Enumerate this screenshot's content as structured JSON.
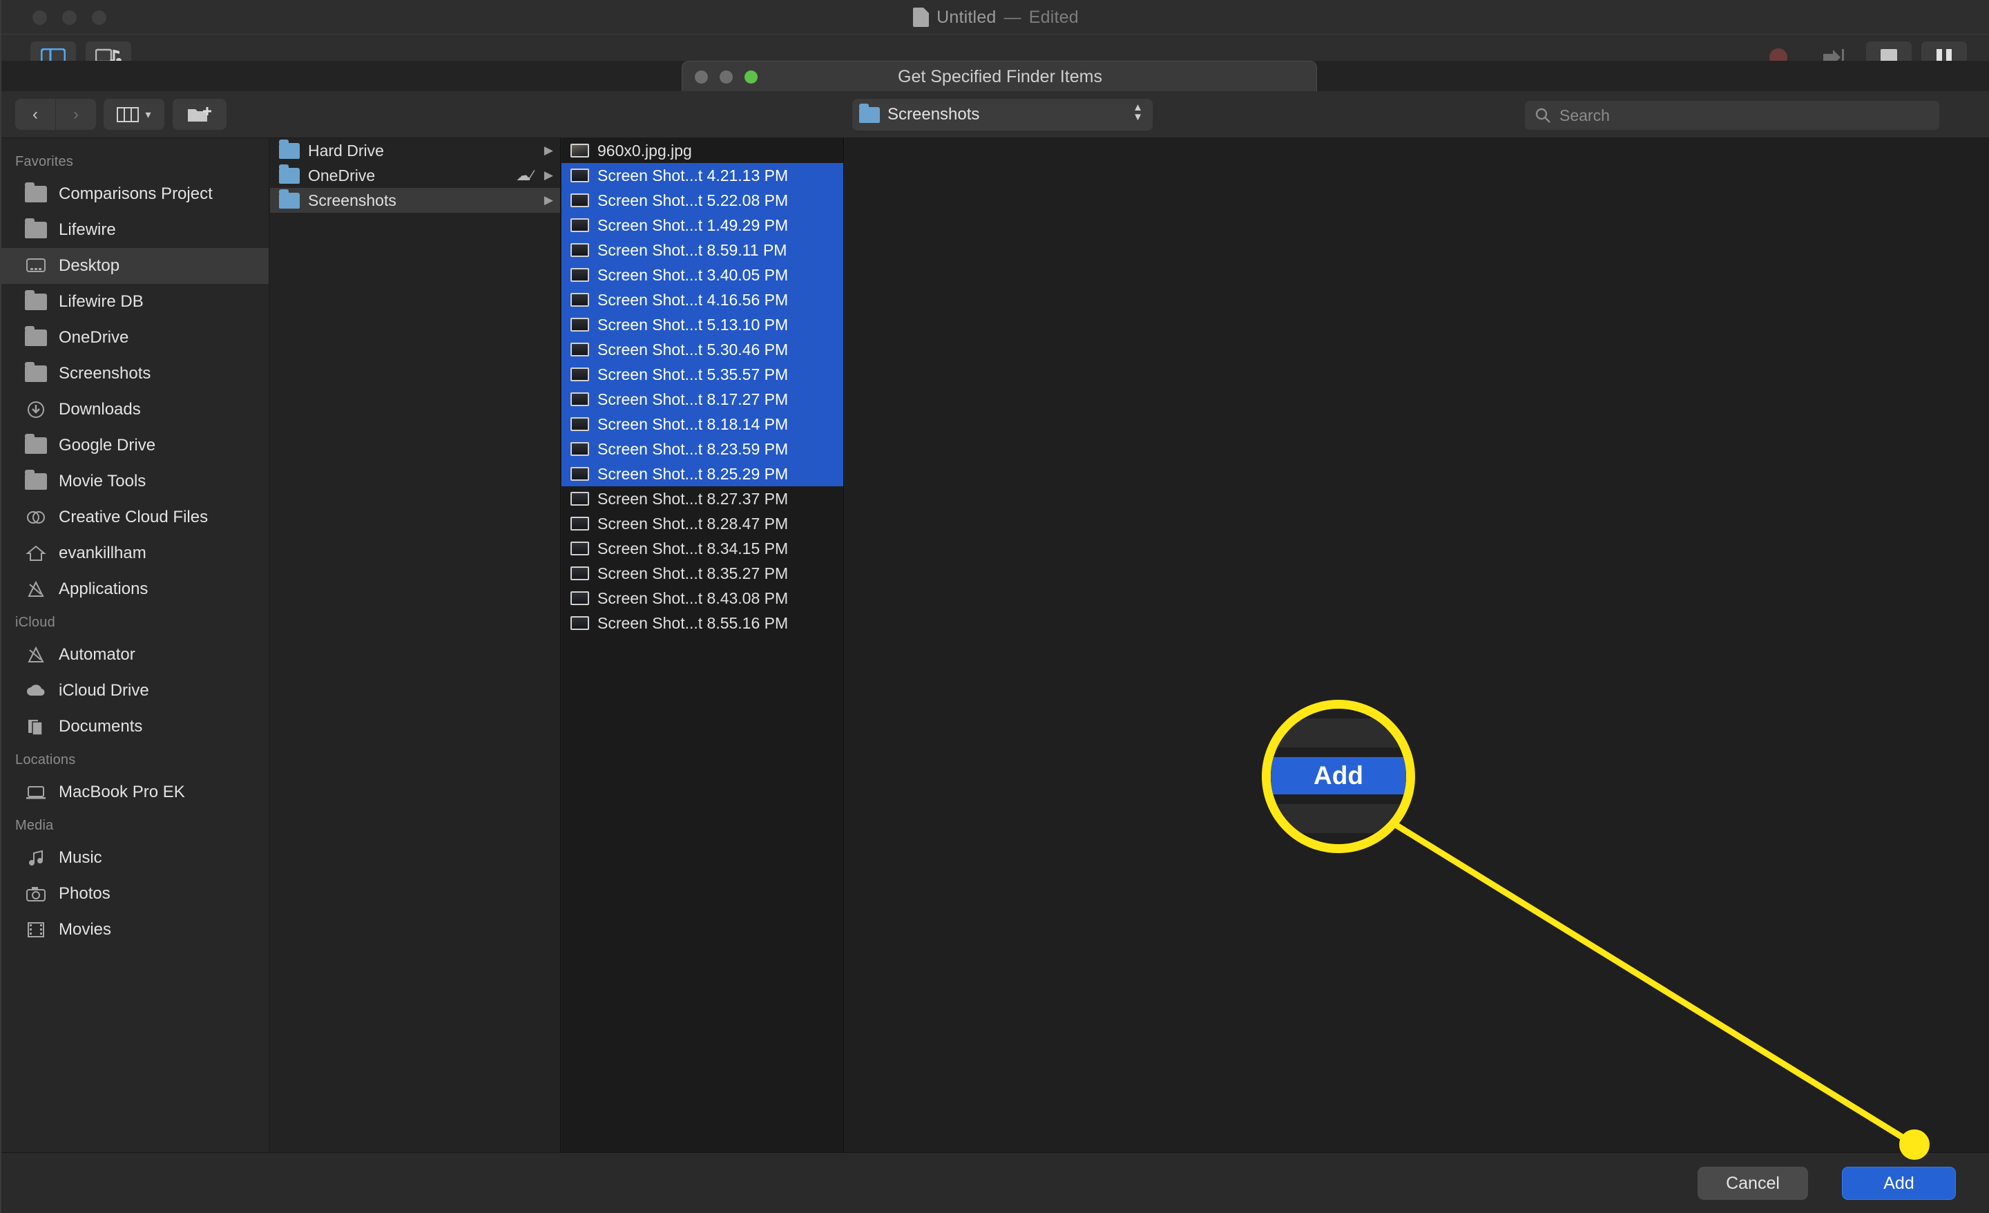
{
  "app": {
    "title": "Untitled",
    "title_separator": "—",
    "title_state": "Edited",
    "toolbar_left": [
      {
        "label": "Library",
        "icon": "library-panel-icon",
        "active": true
      },
      {
        "label": "Media",
        "icon": "media-icon",
        "active": false
      }
    ],
    "toolbar_right": [
      {
        "label": "Record",
        "icon": "record-icon",
        "enabled": false
      },
      {
        "label": "Step",
        "icon": "step-icon",
        "enabled": false
      },
      {
        "label": "Stop",
        "icon": "stop-icon",
        "enabled": true
      },
      {
        "label": "Pause",
        "icon": "pause-icon",
        "enabled": true
      }
    ]
  },
  "dialog": {
    "title": "Get Specified Finder Items",
    "traffic_lights": [
      {
        "name": "close",
        "color": "#6e6e6e"
      },
      {
        "name": "minimize",
        "color": "#6e6e6e"
      },
      {
        "name": "maximize",
        "color": "#5ec14a"
      }
    ],
    "nav": {
      "back_icon": "chevron-left-icon",
      "forward_icon": "chevron-right-icon",
      "view_icon": "column-view-icon",
      "view_chevron": "chevron-down-icon",
      "new_folder_icon": "new-folder-icon"
    },
    "path_popup": {
      "value": "Screenshots",
      "icon": "blue-folder-icon",
      "stepper_icon": "up-down-stepper-icon"
    },
    "search": {
      "placeholder": "Search",
      "icon": "search-icon",
      "value": ""
    },
    "buttons": {
      "cancel": "Cancel",
      "add": "Add"
    }
  },
  "sidebar": {
    "sections": [
      {
        "title": "Favorites",
        "items": [
          {
            "label": "Comparisons Project",
            "icon": "folder-icon",
            "selected": false
          },
          {
            "label": "Lifewire",
            "icon": "folder-icon",
            "selected": false
          },
          {
            "label": "Desktop",
            "icon": "desktop-icon",
            "selected": true
          },
          {
            "label": "Lifewire DB",
            "icon": "folder-icon",
            "selected": false
          },
          {
            "label": "OneDrive",
            "icon": "folder-icon",
            "selected": false
          },
          {
            "label": "Screenshots",
            "icon": "folder-icon",
            "selected": false
          },
          {
            "label": "Downloads",
            "icon": "downloads-icon",
            "selected": false
          },
          {
            "label": "Google Drive",
            "icon": "folder-icon",
            "selected": false
          },
          {
            "label": "Movie Tools",
            "icon": "folder-icon",
            "selected": false
          },
          {
            "label": "Creative Cloud Files",
            "icon": "creative-cloud-icon",
            "selected": false
          },
          {
            "label": "evankillham",
            "icon": "home-icon",
            "selected": false
          },
          {
            "label": "Applications",
            "icon": "applications-icon",
            "selected": false
          }
        ]
      },
      {
        "title": "iCloud",
        "items": [
          {
            "label": "Automator",
            "icon": "automator-icon",
            "selected": false
          },
          {
            "label": "iCloud Drive",
            "icon": "cloud-icon",
            "selected": false
          },
          {
            "label": "Documents",
            "icon": "documents-icon",
            "selected": false
          }
        ]
      },
      {
        "title": "Locations",
        "items": [
          {
            "label": "MacBook Pro EK",
            "icon": "laptop-icon",
            "selected": false
          }
        ]
      },
      {
        "title": "Media",
        "items": [
          {
            "label": "Music",
            "icon": "music-note-icon",
            "selected": false
          },
          {
            "label": "Photos",
            "icon": "camera-icon",
            "selected": false
          },
          {
            "label": "Movies",
            "icon": "film-icon",
            "selected": false
          }
        ]
      }
    ]
  },
  "columns": {
    "column1": [
      {
        "label": "Hard Drive",
        "icon": "blue-folder-icon",
        "selected": false,
        "has_chevron": true,
        "badge": ""
      },
      {
        "label": "OneDrive",
        "icon": "blue-folder-icon",
        "selected": false,
        "has_chevron": true,
        "badge": "cloud-slash-icon"
      },
      {
        "label": "Screenshots",
        "icon": "blue-folder-icon",
        "selected": true,
        "has_chevron": true,
        "badge": ""
      }
    ],
    "column2": [
      {
        "label": "960x0.jpg.jpg",
        "icon": "image-thumbnail",
        "selected": false
      },
      {
        "label": "Screen Shot...t 4.21.13 PM",
        "icon": "screenshot-thumbnail",
        "selected": true
      },
      {
        "label": "Screen Shot...t 5.22.08 PM",
        "icon": "screenshot-thumbnail",
        "selected": true
      },
      {
        "label": "Screen Shot...t 1.49.29 PM",
        "icon": "screenshot-thumbnail",
        "selected": true
      },
      {
        "label": "Screen Shot...t 8.59.11 PM",
        "icon": "screenshot-thumbnail",
        "selected": true
      },
      {
        "label": "Screen Shot...t 3.40.05 PM",
        "icon": "screenshot-thumbnail",
        "selected": true
      },
      {
        "label": "Screen Shot...t 4.16.56 PM",
        "icon": "screenshot-thumbnail",
        "selected": true
      },
      {
        "label": "Screen Shot...t 5.13.10 PM",
        "icon": "screenshot-thumbnail",
        "selected": true
      },
      {
        "label": "Screen Shot...t 5.30.46 PM",
        "icon": "screenshot-thumbnail",
        "selected": true
      },
      {
        "label": "Screen Shot...t 5.35.57 PM",
        "icon": "screenshot-thumbnail",
        "selected": true
      },
      {
        "label": "Screen Shot...t 8.17.27 PM",
        "icon": "screenshot-thumbnail",
        "selected": true
      },
      {
        "label": "Screen Shot...t 8.18.14 PM",
        "icon": "screenshot-thumbnail",
        "selected": true
      },
      {
        "label": "Screen Shot...t 8.23.59 PM",
        "icon": "screenshot-thumbnail",
        "selected": true
      },
      {
        "label": "Screen Shot...t 8.25.29 PM",
        "icon": "screenshot-thumbnail",
        "selected": true
      },
      {
        "label": "Screen Shot...t 8.27.37 PM",
        "icon": "screenshot-thumbnail",
        "selected": false
      },
      {
        "label": "Screen Shot...t 8.28.47 PM",
        "icon": "screenshot-thumbnail",
        "selected": false
      },
      {
        "label": "Screen Shot...t 8.34.15 PM",
        "icon": "screenshot-thumbnail",
        "selected": false
      },
      {
        "label": "Screen Shot...t 8.35.27 PM",
        "icon": "screenshot-thumbnail",
        "selected": false
      },
      {
        "label": "Screen Shot...t 8.43.08 PM",
        "icon": "screenshot-thumbnail",
        "selected": false
      },
      {
        "label": "Screen Shot...t 8.55.16 PM",
        "icon": "screenshot-thumbnail",
        "selected": false
      }
    ]
  },
  "annotation": {
    "magnifier_label": "Add",
    "color": "#ffe815",
    "target_button": "add-button"
  }
}
